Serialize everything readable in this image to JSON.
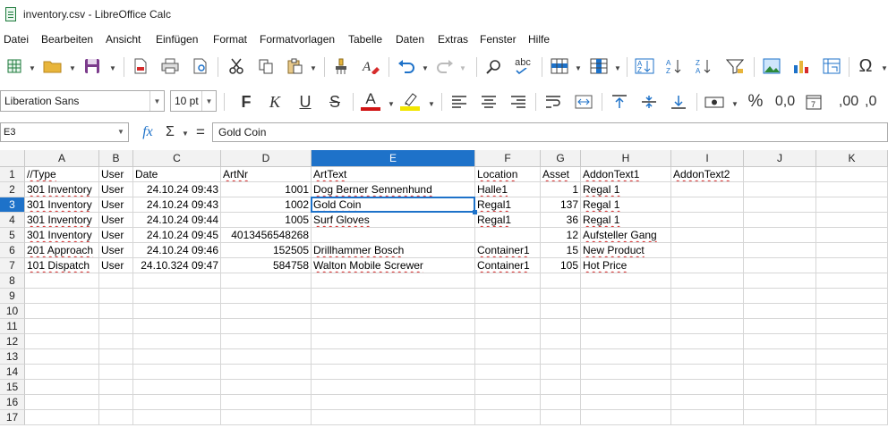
{
  "window": {
    "title": "inventory.csv - LibreOffice Calc"
  },
  "menu": [
    "Datei",
    "Bearbeiten",
    "Ansicht",
    "Einfügen",
    "Format",
    "Formatvorlagen",
    "Tabelle",
    "Daten",
    "Extras",
    "Fenster",
    "Hilfe"
  ],
  "format": {
    "font_name": "Liberation Sans",
    "font_size": "10 pt",
    "bold": "F",
    "italic": "K",
    "underline": "U",
    "strike": "S",
    "font_color_letter": "A",
    "percent": "%",
    "decimal_a": "0,0",
    "decimal_b": ",00",
    "decimal_c": ",0",
    "special_char": "Ω",
    "spell_label": "abc"
  },
  "formula_bar": {
    "cell_ref": "E3",
    "fx": "fx",
    "sigma": "Σ",
    "equals": "=",
    "content": "Gold Coin"
  },
  "colors": {
    "selection": "#1e72c9",
    "font_color_bar": "#d01414",
    "highlight_bar": "#f2e600",
    "spell_underline": "#d62b2b"
  },
  "sheet": {
    "columns": [
      "A",
      "B",
      "C",
      "D",
      "E",
      "F",
      "G",
      "H",
      "I",
      "J",
      "K"
    ],
    "selected_column": "E",
    "selected_row": "3",
    "row_numbers": [
      "1",
      "2",
      "3",
      "4",
      "5",
      "6",
      "7",
      "8",
      "9",
      "10",
      "11",
      "12",
      "13",
      "14",
      "15",
      "16",
      "17"
    ],
    "rows": [
      [
        "//Type",
        "User",
        "Date",
        "ArtNr",
        "ArtText",
        "Location",
        "Asset",
        "AddonText1",
        "AddonText2",
        "",
        ""
      ],
      [
        "301 Inventory",
        "User",
        "24.10.24 09:43",
        "1001",
        "Dog Berner Sennenhund",
        "Halle1",
        "1",
        "Regal 1",
        "",
        "",
        ""
      ],
      [
        "301 Inventory",
        "User",
        "24.10.24 09:43",
        "1002",
        "Gold Coin",
        "Regal1",
        "137",
        "Regal 1",
        "",
        "",
        ""
      ],
      [
        "301 Inventory",
        "User",
        "24.10.24 09:44",
        "1005",
        "Surf Gloves",
        "Regal1",
        "36",
        "Regal 1",
        "",
        "",
        ""
      ],
      [
        "301 Inventory",
        "User",
        "24.10.24 09:45",
        "4013456548268",
        "",
        "",
        "12",
        "Aufsteller Gang",
        "",
        "",
        ""
      ],
      [
        "201 Approach",
        "User",
        "24.10.24 09:46",
        "152505",
        "Drillhammer Bosch",
        "Container1",
        "15",
        "New Product",
        "",
        "",
        ""
      ],
      [
        "101 Dispatch",
        "User",
        "24.10.324 09:47",
        "584758",
        "Walton Mobile Screwer",
        "Container1",
        "105",
        "Hot Price",
        "",
        "",
        ""
      ]
    ]
  }
}
